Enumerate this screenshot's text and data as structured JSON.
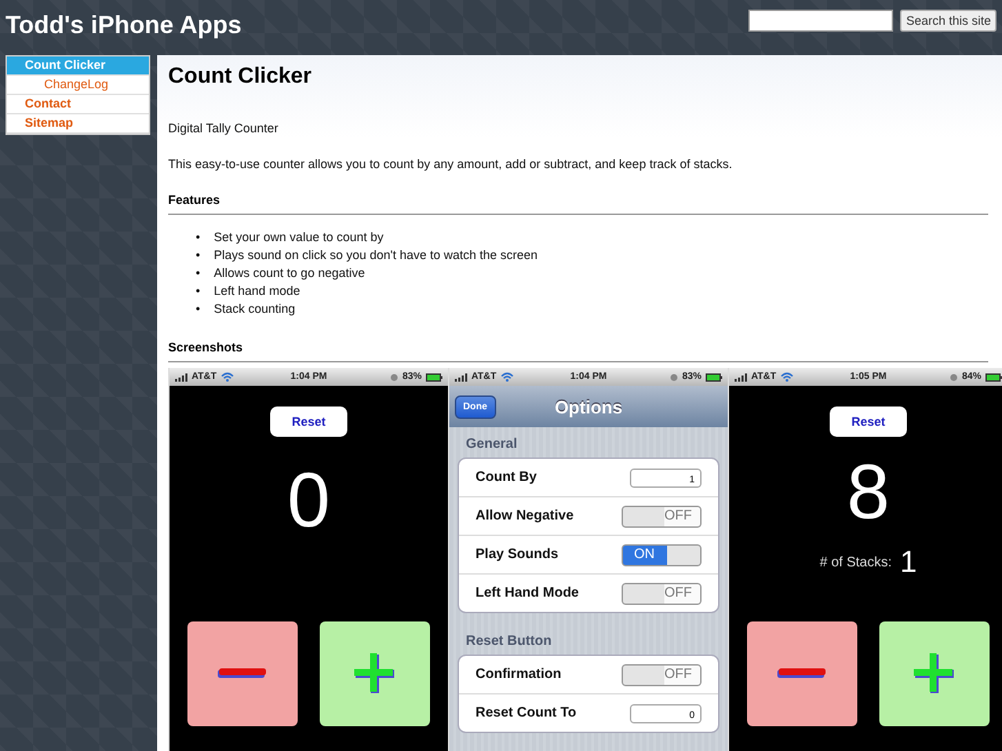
{
  "site_title": "Todd's iPhone Apps",
  "search": {
    "button": "Search this site"
  },
  "nav": [
    {
      "label": "Count Clicker",
      "selected": true,
      "children": [
        {
          "label": "ChangeLog",
          "selected": false
        }
      ]
    },
    {
      "label": "Contact",
      "selected": false
    },
    {
      "label": "Sitemap",
      "selected": false
    }
  ],
  "page": {
    "title": "Count Clicker",
    "subtitle": "Digital Tally Counter",
    "intro": "This easy-to-use counter allows you to count by any amount, add or subtract, and keep track of stacks.",
    "features_heading": "Features",
    "features": [
      {
        "bullet": "•",
        "text": "Set your own value to count by"
      },
      {
        "bullet": "•",
        "text": "Plays sound on click so you don't have to watch the screen"
      },
      {
        "bullet": "•",
        "text": "Allows count to go negative"
      },
      {
        "bullet": "•",
        "text": "Left hand mode"
      },
      {
        "bullet": "•",
        "text": "Stack counting"
      }
    ],
    "screenshots_heading": "Screenshots"
  },
  "screenshots": [
    {
      "kind": "counter",
      "status": {
        "carrier": "AT&T",
        "time": "1:04 PM",
        "battery": "83%"
      },
      "reset": "Reset",
      "count": "0"
    },
    {
      "kind": "options",
      "status": {
        "carrier": "AT&T",
        "time": "1:04 PM",
        "battery": "83%"
      },
      "done": "Done",
      "title": "Options",
      "sections": [
        {
          "header": "General",
          "rows": [
            {
              "kind": "field",
              "label": "Count By",
              "value": "1"
            },
            {
              "kind": "switch",
              "label": "Allow Negative",
              "on": false,
              "value": "OFF"
            },
            {
              "kind": "switch",
              "label": "Play Sounds",
              "on": true,
              "value": "ON"
            },
            {
              "kind": "switch",
              "label": "Left Hand Mode",
              "on": false,
              "value": "OFF"
            }
          ]
        },
        {
          "header": "Reset Button",
          "rows": [
            {
              "kind": "switch",
              "label": "Confirmation",
              "on": false,
              "value": "OFF"
            },
            {
              "kind": "field",
              "label": "Reset Count To",
              "value": "0"
            }
          ]
        }
      ]
    },
    {
      "kind": "counter",
      "status": {
        "carrier": "AT&T",
        "time": "1:05 PM",
        "battery": "84%"
      },
      "reset": "Reset",
      "count": "8",
      "stacks_label": "# of Stacks:",
      "stacks_value": "1"
    }
  ]
}
